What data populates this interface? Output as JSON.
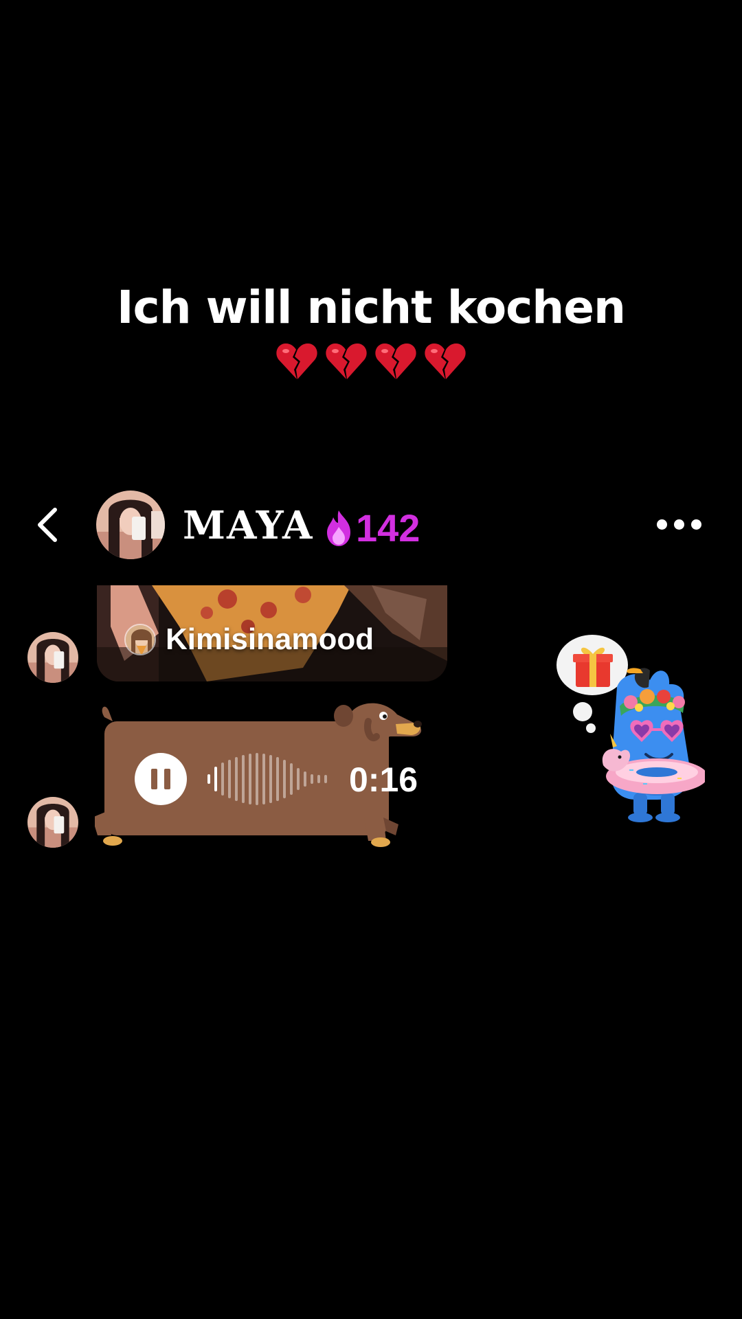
{
  "caption": {
    "text": "Ich will nicht kochen",
    "emoji": "💔💔💔💔"
  },
  "chat_header": {
    "back_icon": "chevron-left-icon",
    "contact_name": "MAYA",
    "streak_icon": "flame-icon",
    "streak_count": "142",
    "more_icon": "more-horizontal-icon"
  },
  "messages": {
    "shared_post": {
      "author": "Kimisinamood"
    },
    "voice_message": {
      "state_icon": "pause-icon",
      "duration": "0:16",
      "played_fraction": 0.08
    }
  },
  "sticker": {
    "name": "blue-monster-sticker",
    "thought_icon": "gift-icon"
  },
  "colors": {
    "background": "#000000",
    "voice_bubble": "#8b5c43",
    "streak": "#d22fe0",
    "broken_heart": "#d9192e"
  }
}
